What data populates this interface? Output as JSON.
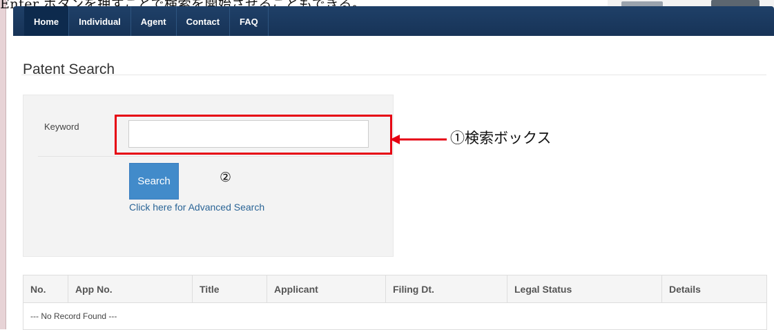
{
  "document": {
    "top_text": "Enter ボタンを押すことで検索を開始させることもできる。",
    "annotation_search_box": "①検索ボックス",
    "annotation_search_button": "②"
  },
  "navbar": {
    "items": [
      {
        "label": "Home",
        "active": true
      },
      {
        "label": "Individual"
      },
      {
        "label": "Agent"
      },
      {
        "label": "Contact"
      },
      {
        "label": "FAQ"
      }
    ]
  },
  "page": {
    "title": "Patent Search"
  },
  "search": {
    "keyword_label": "Keyword",
    "keyword_value": "",
    "search_button_label": "Search",
    "advanced_link": "Click here for Advanced Search"
  },
  "results": {
    "columns": [
      "No.",
      "App No.",
      "Title",
      "Applicant",
      "Filing Dt.",
      "Legal Status",
      "Details"
    ],
    "empty_message": "--- No Record Found ---"
  },
  "colors": {
    "navbar": "#1f4068",
    "highlight": "#e60012",
    "search_button": "#428bca",
    "link": "#2a6496"
  }
}
